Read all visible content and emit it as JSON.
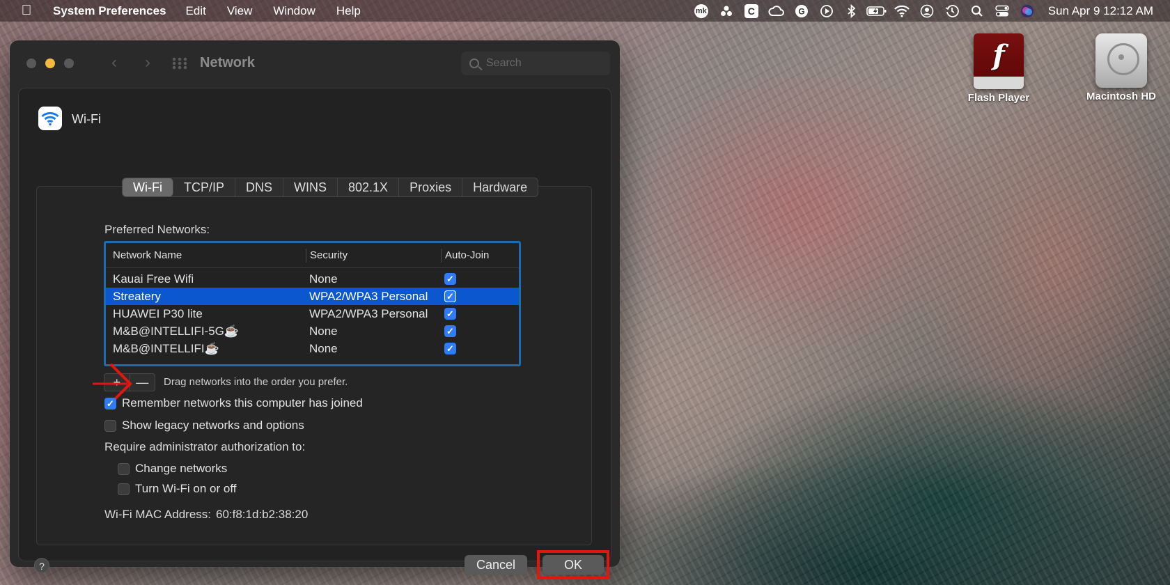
{
  "menubar": {
    "app_name": "System Preferences",
    "menus": [
      "Edit",
      "View",
      "Window",
      "Help"
    ],
    "clock": "Sun Apr 9  12:12 AM",
    "status_icons": [
      "mk-icon",
      "bartender-icon",
      "c-icon",
      "creative-cloud-icon",
      "grammarly-icon",
      "play-icon",
      "bluetooth-icon",
      "battery-icon",
      "wifi-icon",
      "user-icon",
      "time-machine-icon",
      "search-icon",
      "control-center-icon",
      "siri-icon"
    ]
  },
  "desktop": {
    "flash_player": "Flash Player",
    "macintosh_hd": "Macintosh HD"
  },
  "window": {
    "title": "Network",
    "search_placeholder": "Search"
  },
  "sheet": {
    "interface": "Wi-Fi",
    "tabs": [
      "Wi-Fi",
      "TCP/IP",
      "DNS",
      "WINS",
      "802.1X",
      "Proxies",
      "Hardware"
    ],
    "active_tab": "Wi-Fi",
    "preferred_label": "Preferred Networks:",
    "columns": [
      "Network Name",
      "Security",
      "Auto-Join"
    ],
    "networks": [
      {
        "name": "Kauai Free Wifi",
        "security": "None",
        "auto_join": true
      },
      {
        "name": "Streatery",
        "security": "WPA2/WPA3 Personal",
        "auto_join": true
      },
      {
        "name": "HUAWEI P30 lite",
        "security": "WPA2/WPA3 Personal",
        "auto_join": true
      },
      {
        "name": "M&B@INTELLIFI-5G☕",
        "security": "None",
        "auto_join": true
      },
      {
        "name": "M&B@INTELLIFI☕",
        "security": "None",
        "auto_join": true
      }
    ],
    "selected_network": "Streatery",
    "drag_hint": "Drag networks into the order you prefer.",
    "remember_label": "Remember networks this computer has joined",
    "legacy_label": "Show legacy networks and options",
    "require_label": "Require administrator authorization to:",
    "change_networks_label": "Change networks",
    "turn_wifi_label": "Turn Wi-Fi on or off",
    "mac_label": "Wi-Fi MAC Address:",
    "mac_value": "60:f8:1d:b2:38:20",
    "cancel_label": "Cancel",
    "ok_label": "OK",
    "help_label": "?",
    "plus": "+",
    "minus": "—"
  }
}
